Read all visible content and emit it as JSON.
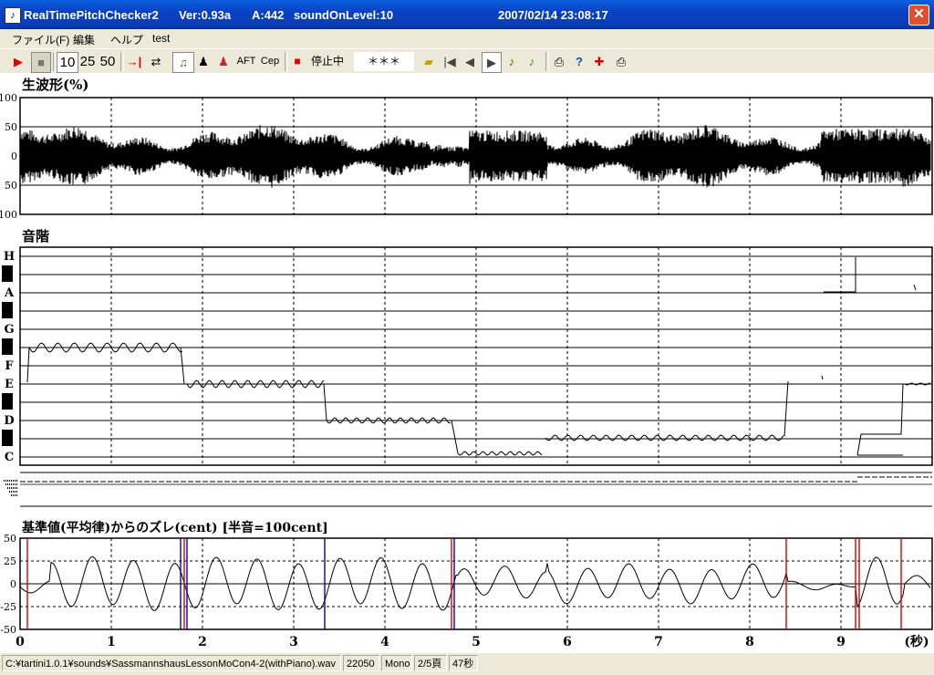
{
  "window": {
    "app_name": "RealTimePitchChecker2",
    "version": "Ver:0.93a",
    "a_ref": "A:442",
    "sound_on": "soundOnLevel:10",
    "datetime": "2007/02/14 23:08:17",
    "close": "✕"
  },
  "menu": [
    "ファイル(F)",
    "編集",
    "ヘルプ",
    "test"
  ],
  "toolbar": {
    "play": "▶",
    "stop": "■",
    "range_10": "10",
    "range_25": "25",
    "range_50": "50",
    "aft": "AFT",
    "cep": "Cep",
    "state": "停止中",
    "note_display": "＊＊＊"
  },
  "icons": [
    "play-icon",
    "stop-icon",
    "skip-to-end-icon",
    "loop-icon",
    "violin-icon",
    "person-icon",
    "person-red-icon",
    "record-icon",
    "open-folder-icon",
    "first-icon",
    "prev-icon",
    "next-icon",
    "note-icon",
    "note-green-icon",
    "print-icon",
    "help-icon",
    "crosshair-icon",
    "printer-icon"
  ],
  "panels": {
    "waveform_title": "生波形(%)",
    "scale_title": "音階",
    "cent_title": "基準値(平均律)からのズレ(cent) [半音=100cent]",
    "wave_ticks": [
      "100",
      "50",
      "0",
      "50",
      "100"
    ],
    "note_labels": [
      "H",
      "A",
      "G",
      "F",
      "E",
      "D",
      "C"
    ],
    "cent_ticks": [
      "50",
      "25",
      "0",
      "-25",
      "-50"
    ],
    "x_ticks": [
      "0",
      "1",
      "2",
      "3",
      "4",
      "5",
      "6",
      "7",
      "8",
      "9"
    ],
    "x_unit": "(秒)"
  },
  "status": {
    "path": "C:¥tartini1.0.1¥sounds¥SassmannshausLessonMoCon4-2(withPiano).wav",
    "rate": "22050",
    "channels": "Mono",
    "page": "2/5頁",
    "duration": "47秒"
  },
  "colors": {
    "title_blue": "#0a3eb8",
    "wave": "#000000",
    "red_marker": "#dd0000",
    "blue_marker": "#0000cc"
  }
}
